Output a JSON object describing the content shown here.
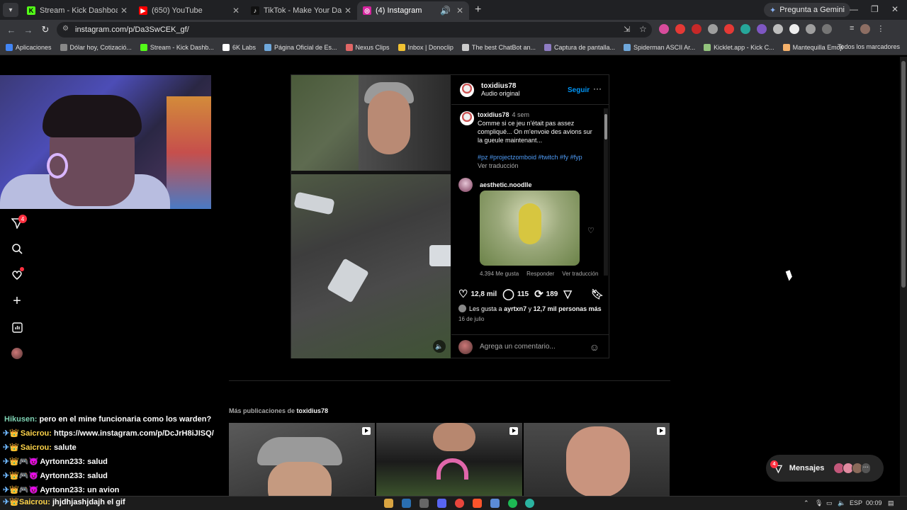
{
  "browser": {
    "tabs": [
      {
        "title": "Stream - Kick Dashboard",
        "favicon_color": "#53fc18",
        "favicon_letter": "K",
        "active": false
      },
      {
        "title": "(650) YouTube",
        "favicon_color": "#ff0000",
        "favicon_letter": "▶",
        "active": false
      },
      {
        "title": "TikTok - Make Your Day",
        "favicon_color": "#111111",
        "favicon_letter": "♪",
        "active": false
      },
      {
        "title": "(4) Instagram",
        "favicon_color": "#d6249f",
        "favicon_letter": "◎",
        "active": true
      }
    ],
    "gemini_label": "Pregunta a Gemini",
    "url": "instagram.com/p/Da3SwCEK_gf/",
    "bookmarks": [
      {
        "label": "Aplicaciones",
        "color": "#4285f4"
      },
      {
        "label": "Dólar hoy, Cotizació...",
        "color": "#888888"
      },
      {
        "label": "Stream - Kick Dashb...",
        "color": "#53fc18"
      },
      {
        "label": "6K Labs",
        "color": "#ffffff"
      },
      {
        "label": "Página Oficial de Es...",
        "color": "#6fa8dc"
      },
      {
        "label": "Nexus Clips",
        "color": "#e06666"
      },
      {
        "label": "Inbox | Donoclip",
        "color": "#f1c232"
      },
      {
        "label": "The best ChatBot an...",
        "color": "#cccccc"
      },
      {
        "label": "Captura de pantalla...",
        "color": "#8e7cc3"
      },
      {
        "label": "Spiderman ASCII Ar...",
        "color": "#6fa8dc"
      },
      {
        "label": "Kicklet.app - Kick C...",
        "color": "#93c47d"
      },
      {
        "label": "Mantequilla Emoji",
        "color": "#f6b26b"
      }
    ],
    "bookmarks_all": "Todos los marcadores"
  },
  "sidebar": {
    "items": [
      {
        "name": "messages",
        "icon": "send-icon",
        "badge": "4"
      },
      {
        "name": "search",
        "icon": "search-icon"
      },
      {
        "name": "notifications",
        "icon": "heart-icon"
      },
      {
        "name": "create",
        "icon": "plus-icon"
      },
      {
        "name": "dashboard",
        "icon": "chart-icon"
      },
      {
        "name": "profile",
        "icon": "avatar"
      }
    ]
  },
  "post": {
    "username": "toxidius78",
    "audio": "Audio original",
    "follow_label": "Seguir",
    "more_label": "···",
    "caption_user": "toxidius78",
    "caption_time": "4 sem",
    "caption": "Comme si ce jeu n'était pas assez compliqué... On m'envoie des avions sur la gueule maintenant...",
    "tags": "#pz #projectzomboid #twitch #fy #fyp",
    "see_translation": "Ver traducción",
    "comment2_user": "aesthetic.noodlle",
    "comment2_likes": "4.394 Me gusta",
    "comment2_reply": "Responder",
    "comment2_translation": "Ver traducción",
    "likes_count": "12,8 mil",
    "comments_count": "115",
    "reposts_count": "189",
    "liked_by_prefix": "Les gusta a",
    "liked_by_user": "ayrtxn7",
    "liked_by_suffix_a": "y",
    "liked_by_others": "12,7 mil personas más",
    "date": "16 de julio",
    "add_comment_placeholder": "Agrega un comentario..."
  },
  "more_posts": {
    "label": "Más publicaciones de",
    "user": "toxidius78",
    "thumbs": [
      {
        "name": "thumb-1",
        "bg": "#6a6a6a"
      },
      {
        "name": "thumb-2",
        "bg": "#2e3a30"
      },
      {
        "name": "thumb-3",
        "bg": "#3c3c3c"
      }
    ]
  },
  "chat": [
    {
      "user": "Hikusen:",
      "text": "pero en el mine funcionaria como los warden?",
      "style": "u1",
      "badges": ""
    },
    {
      "user": "Saicrou:",
      "text": "https://www.instagram.com/p/DcJrH8iJISQ/",
      "style": "u2",
      "badges": "✈👑"
    },
    {
      "user": "Saicrou:",
      "text": "salute",
      "style": "u2",
      "badges": "✈👑"
    },
    {
      "user": "Ayrtonn233:",
      "text": "salud",
      "style": "plain",
      "badges": "✈👑🎮😈"
    },
    {
      "user": "Ayrtonn233:",
      "text": "salud",
      "style": "plain",
      "badges": "✈👑🎮😈"
    },
    {
      "user": "Ayrtonn233:",
      "text": "un avion",
      "style": "plain",
      "badges": "✈👑🎮😈"
    }
  ],
  "chat_last": {
    "user": "Saicrou:",
    "text": "jhjdhjashjdajh el gif",
    "badges": "✈👑"
  },
  "messages_pill": {
    "label": "Mensajes",
    "badge": "4"
  },
  "taskbar": {
    "lang": "ESP",
    "time": "00:09"
  }
}
